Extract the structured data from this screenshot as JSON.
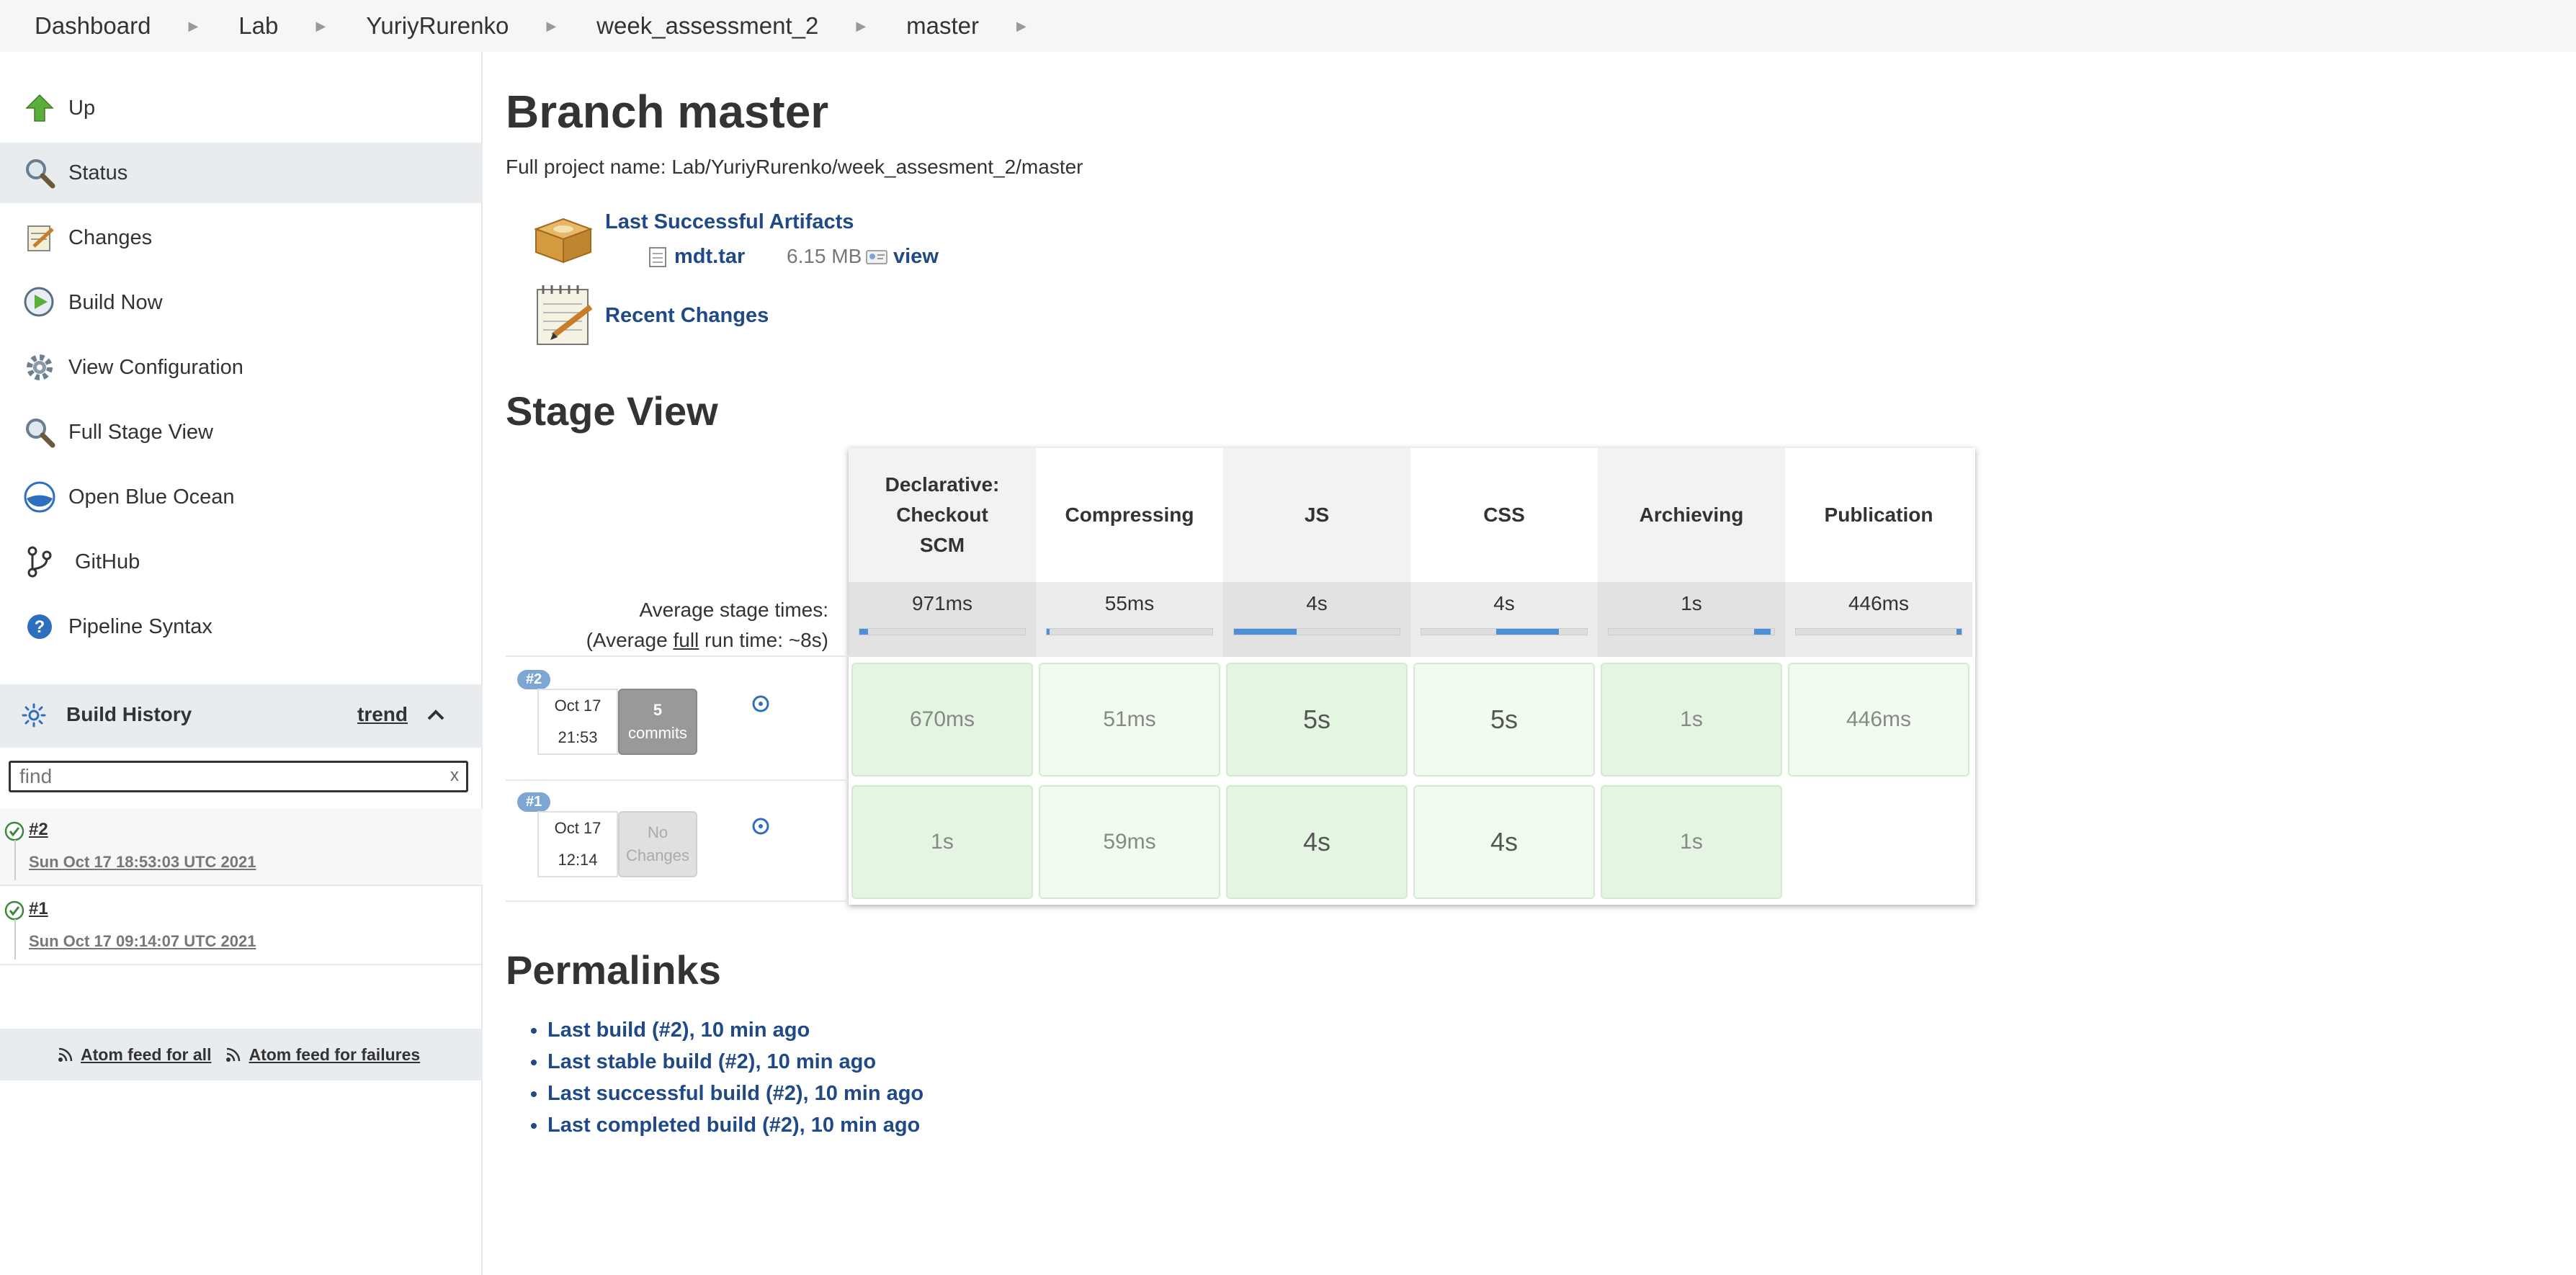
{
  "breadcrumb": [
    "Dashboard",
    "Lab",
    "YuriyRurenko",
    "week_assessment_2",
    "master"
  ],
  "sidebar": {
    "items": [
      {
        "label": "Up",
        "icon": "up-arrow-icon"
      },
      {
        "label": "Status",
        "icon": "magnifier-icon"
      },
      {
        "label": "Changes",
        "icon": "notepad-icon"
      },
      {
        "label": "Build Now",
        "icon": "clock-play-icon"
      },
      {
        "label": "View Configuration",
        "icon": "gear-icon"
      },
      {
        "label": "Full Stage View",
        "icon": "magnifier-icon"
      },
      {
        "label": "Open Blue Ocean",
        "icon": "blue-ocean-icon"
      },
      {
        "label": "GitHub",
        "icon": "git-branch-icon"
      },
      {
        "label": "Pipeline Syntax",
        "icon": "help-icon"
      }
    ]
  },
  "build_history": {
    "title": "Build History",
    "trend_label": "trend",
    "search_placeholder": "find",
    "clear_label": "x",
    "builds": [
      {
        "number": "#2",
        "date": "Sun Oct 17 18:53:03 UTC 2021"
      },
      {
        "number": "#1",
        "date": "Sun Oct 17 09:14:07 UTC 2021"
      }
    ],
    "feed_all": "Atom feed for all",
    "feed_failures": "Atom feed for failures"
  },
  "main": {
    "title": "Branch master",
    "full_name": "Full project name: Lab/YuriyRurenko/week_assesment_2/master",
    "last_artifacts_label": "Last Successful Artifacts",
    "artifact_name": "mdt.tar",
    "artifact_size": "6.15 MB",
    "artifact_view": "view",
    "recent_changes": "Recent Changes"
  },
  "stage_view": {
    "title": "Stage View",
    "avg_label": "Average stage times:",
    "avg_run_prefix": "(Average ",
    "avg_run_full": "full",
    "avg_run_suffix": " run time: ~8s)",
    "stages": [
      {
        "name": "Declarative: Checkout SCM",
        "avg": "971ms",
        "bar_fill": 0.05,
        "bar_start": 0.0
      },
      {
        "name": "Compressing",
        "avg": "55ms",
        "bar_fill": 0.01,
        "bar_start": 0.0
      },
      {
        "name": "JS",
        "avg": "4s",
        "bar_fill": 0.38,
        "bar_start": 0.0
      },
      {
        "name": "CSS",
        "avg": "4s",
        "bar_fill": 0.38,
        "bar_start": 0.45
      },
      {
        "name": "Archieving",
        "avg": "1s",
        "bar_fill": 0.1,
        "bar_start": 0.88
      },
      {
        "name": "Publication",
        "avg": "446ms",
        "bar_fill": 0.03,
        "bar_start": 0.97
      }
    ],
    "runs": [
      {
        "badge": "#2",
        "date": "Oct 17",
        "time": "21:53",
        "commits_line1": "5",
        "commits_line2": "commits",
        "has_commits": true,
        "times": [
          "670ms",
          "51ms",
          "5s",
          "5s",
          "1s",
          "446ms"
        ]
      },
      {
        "badge": "#1",
        "date": "Oct 17",
        "time": "12:14",
        "commits_line1": "No",
        "commits_line2": "Changes",
        "has_commits": false,
        "times": [
          "1s",
          "59ms",
          "4s",
          "4s",
          "1s",
          ""
        ]
      }
    ]
  },
  "permalinks": {
    "title": "Permalinks",
    "links": [
      "Last build (#2), 10 min ago",
      "Last stable build (#2), 10 min ago",
      "Last successful build (#2), 10 min ago",
      "Last completed build (#2), 10 min ago"
    ]
  },
  "colors": {
    "link": "#204a87",
    "success_cell": "#e4f6e1",
    "badge": "#7da6d3",
    "bar": "#4a90d9"
  }
}
